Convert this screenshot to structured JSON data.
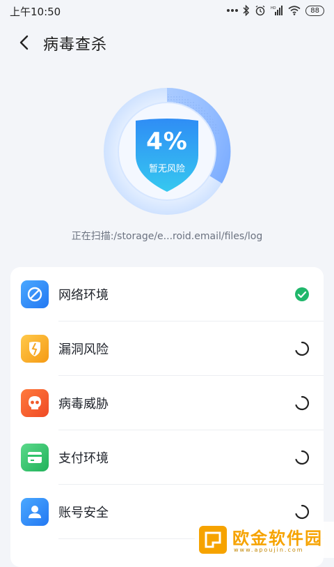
{
  "status_bar": {
    "time": "上午10:50",
    "battery": "88"
  },
  "header": {
    "title": "病毒查杀"
  },
  "scan": {
    "percent": "4%",
    "progress": 0.04,
    "risk_text": "暂无风险",
    "path": "正在扫描:/storage/e...roid.email/files/log"
  },
  "items": [
    {
      "label": "网络环境",
      "icon": "network-icon",
      "status": "done",
      "color": "#2f8ef9"
    },
    {
      "label": "漏洞风险",
      "icon": "vulnerability-icon",
      "status": "scanning",
      "color": "#f7a41d"
    },
    {
      "label": "病毒威胁",
      "icon": "virus-icon",
      "status": "scanning",
      "color": "#f2582b"
    },
    {
      "label": "支付环境",
      "icon": "payment-icon",
      "status": "scanning",
      "color": "#2ec26a"
    },
    {
      "label": "账号安全",
      "icon": "account-icon",
      "status": "scanning",
      "color": "#2f8ef9"
    }
  ],
  "watermark": {
    "text": "欧金软件园",
    "domain": "www.apoujin.com"
  }
}
